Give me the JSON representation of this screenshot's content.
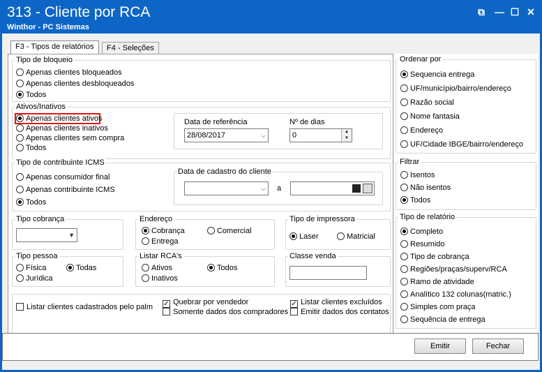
{
  "window": {
    "title": "313 - Cliente por RCA",
    "subtitle": "Winthor - PC Sistemas",
    "btn_restore": "⧉",
    "btn_min": "—",
    "btn_max": "☐",
    "btn_close": "✕"
  },
  "tabs": [
    {
      "label": "F3 - Tipos de relatórios"
    },
    {
      "label": "F4 - Seleções"
    }
  ],
  "tipo_bloqueio": {
    "title": "Tipo de bloqueio",
    "options": [
      "Apenas clientes bloqueados",
      "Apenas clientes desbloqueados",
      "Todos"
    ]
  },
  "ativos": {
    "title": "Ativos/Inativos",
    "options": [
      "Apenas clientes ativos",
      "Apenas clientes inativos",
      "Apenas clientes sem compra",
      "Todos"
    ]
  },
  "data_ref": {
    "label": "Data de referência",
    "value": "28/08/2017"
  },
  "num_dias": {
    "label": "Nº de dias",
    "value": "0"
  },
  "icms": {
    "title": "Tipo de contribuinte ICMS",
    "options": [
      "Apenas consumidor final",
      "Apenas contribuinte ICMS",
      "Todos"
    ]
  },
  "data_cad": {
    "title": "Data de cadastro do cliente",
    "sep": "a"
  },
  "cobranca": {
    "title": "Tipo cobrança"
  },
  "endereco": {
    "title": "Endereço",
    "options": [
      "Cobrança",
      "Comercial",
      "Entrega"
    ]
  },
  "impressora": {
    "title": "Tipo de impressora",
    "options": [
      "Laser",
      "Matricial"
    ]
  },
  "pessoa": {
    "title": "Tipo pessoa",
    "options": [
      "Física",
      "Todas",
      "Jurídica"
    ]
  },
  "rcas": {
    "title": "Listar RCA's",
    "options": [
      "Ativos",
      "Todos",
      "Inativos"
    ]
  },
  "classe": {
    "title": "Classe venda"
  },
  "checks": [
    "Listar clientes cadastrados pelo palm",
    "Quebrar por vendedor",
    "Somente dados dos compradores",
    "Listar clientes excluídos",
    "Emitir dados dos contatos"
  ],
  "ordenar": {
    "title": "Ordenar por",
    "options": [
      "Sequencia entrega",
      "UF/município/bairro/endereço",
      "Razão social",
      "Nome fantasia",
      "Endereço",
      "UF/Cidade IBGE/bairro/endereço"
    ]
  },
  "filtrar": {
    "title": "Filtrar",
    "options": [
      "Isentos",
      "Não isentos",
      "Todos"
    ]
  },
  "relatorio": {
    "title": "Tipo de relatório",
    "options": [
      "Completo",
      "Resumido",
      "Tipo de cobrança",
      "Regiões/praças/superv/RCA",
      "Ramo de atividade",
      "Analítico 132 colunas(matric.)",
      "Simples com praça",
      "Sequência de entrega"
    ]
  },
  "buttons": {
    "emitir": "Emitir",
    "fechar": "Fechar"
  }
}
